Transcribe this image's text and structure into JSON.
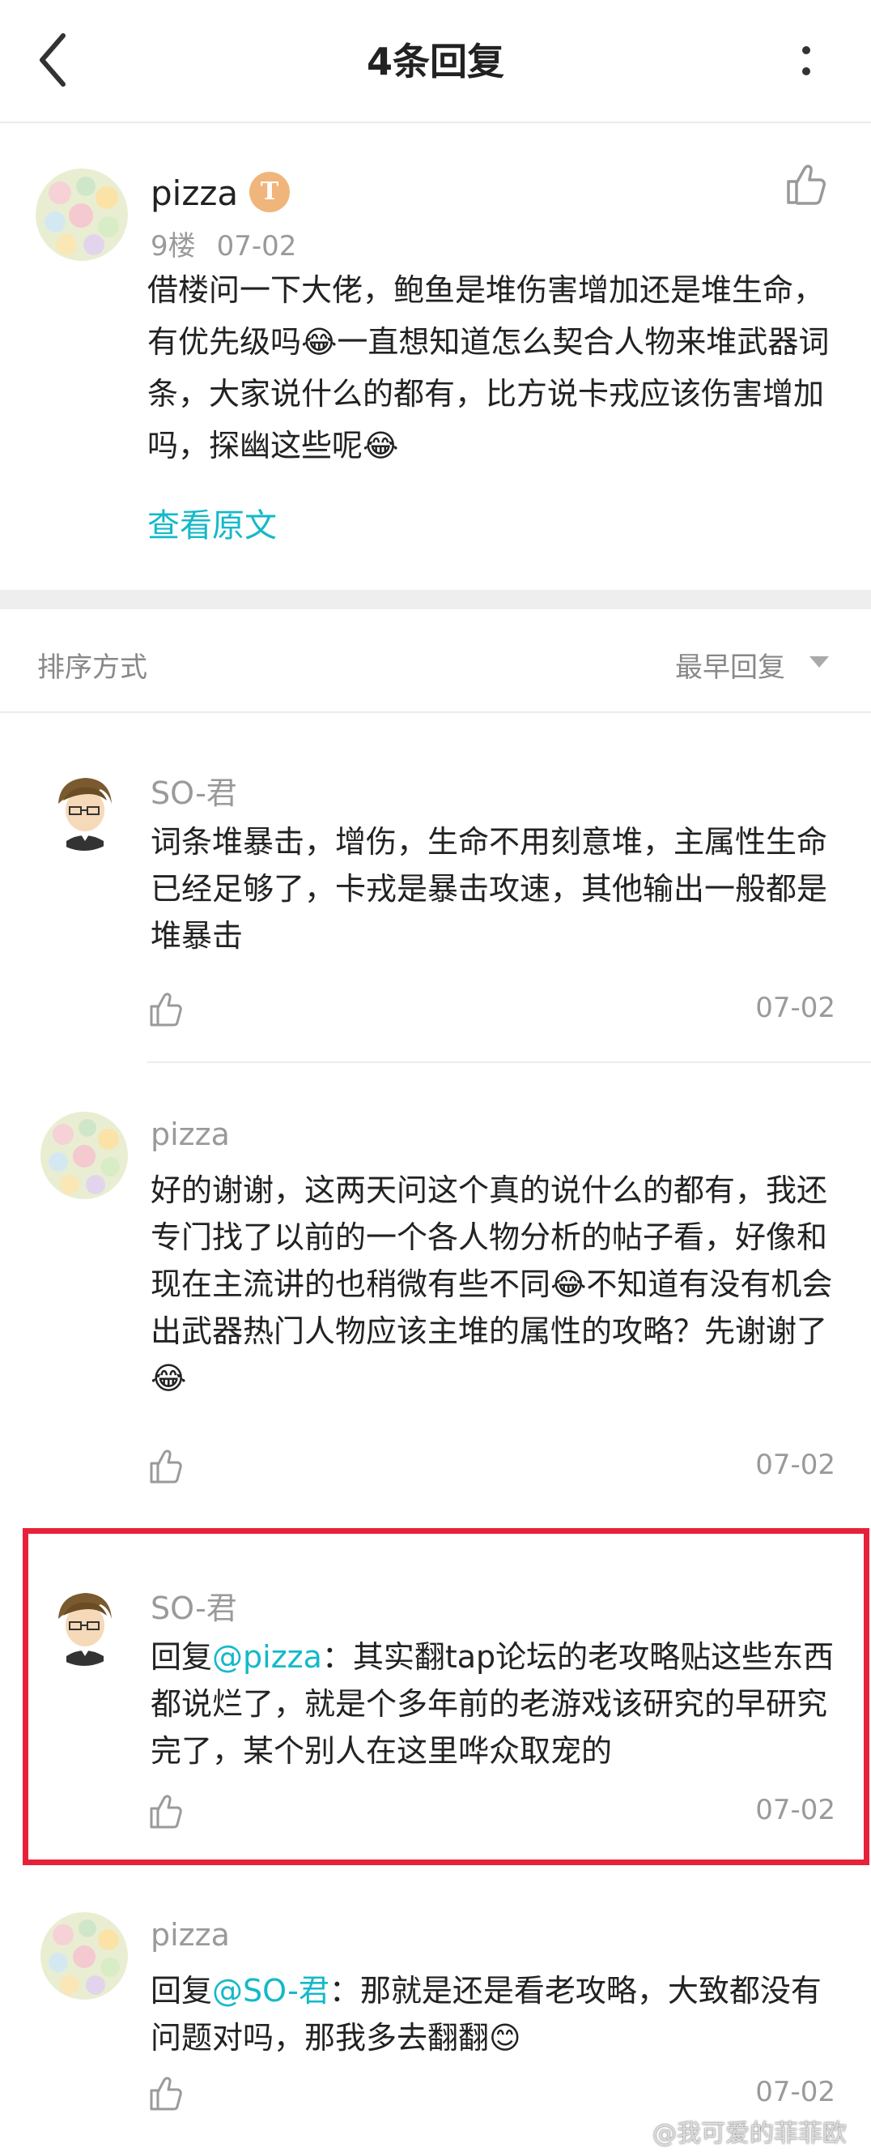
{
  "header": {
    "title": "4条回复",
    "back_icon": "chevron-left-icon",
    "more_icon": "more-vertical-icon"
  },
  "post": {
    "author": "pizza",
    "badge": "T",
    "floor": "9楼",
    "date": "07-02",
    "body": "借楼问一下大佬，鲍鱼是堆伤害增加还是堆生命，有优先级吗😂一直想知道怎么契合人物来堆武器词条，大家说什么的都有，比方说卡戎应该伤害增加吗，探幽这些呢😂",
    "view_original": "查看原文"
  },
  "sort": {
    "label": "排序方式",
    "value": "最早回复"
  },
  "replies": [
    {
      "author": "SO-君",
      "body": "词条堆暴击，增伤，生命不用刻意堆，主属性生命已经足够了，卡戎是暴击攻速，其他输出一般都是堆暴击",
      "date": "07-02"
    },
    {
      "author": "pizza",
      "body": "好的谢谢，这两天问这个真的说什么的都有，我还专门找了以前的一个各人物分析的帖子看，好像和现在主流讲的也稍微有些不同😂不知道有没有机会出武器热门人物应该主堆的属性的攻略？先谢谢了😂",
      "date": "07-02"
    },
    {
      "author": "SO-君",
      "reply_prefix": "回复",
      "mention": "@pizza",
      "body": "：其实翻tap论坛的老攻略贴这些东西都说烂了，就是个多年前的老游戏该研究的早研究完了，某个别人在这里哗众取宠的",
      "date": "07-02"
    },
    {
      "author": "pizza",
      "reply_prefix": "回复",
      "mention": "@SO-君",
      "body": "：那就是还是看老攻略，大致都没有问题对吗，那我多去翻翻😊",
      "date": "07-02"
    }
  ],
  "watermark": "@我可爱的菲菲欧",
  "colors": {
    "accent": "#14b9c8",
    "highlight": "#e8213a",
    "muted": "#9a9a9a"
  }
}
